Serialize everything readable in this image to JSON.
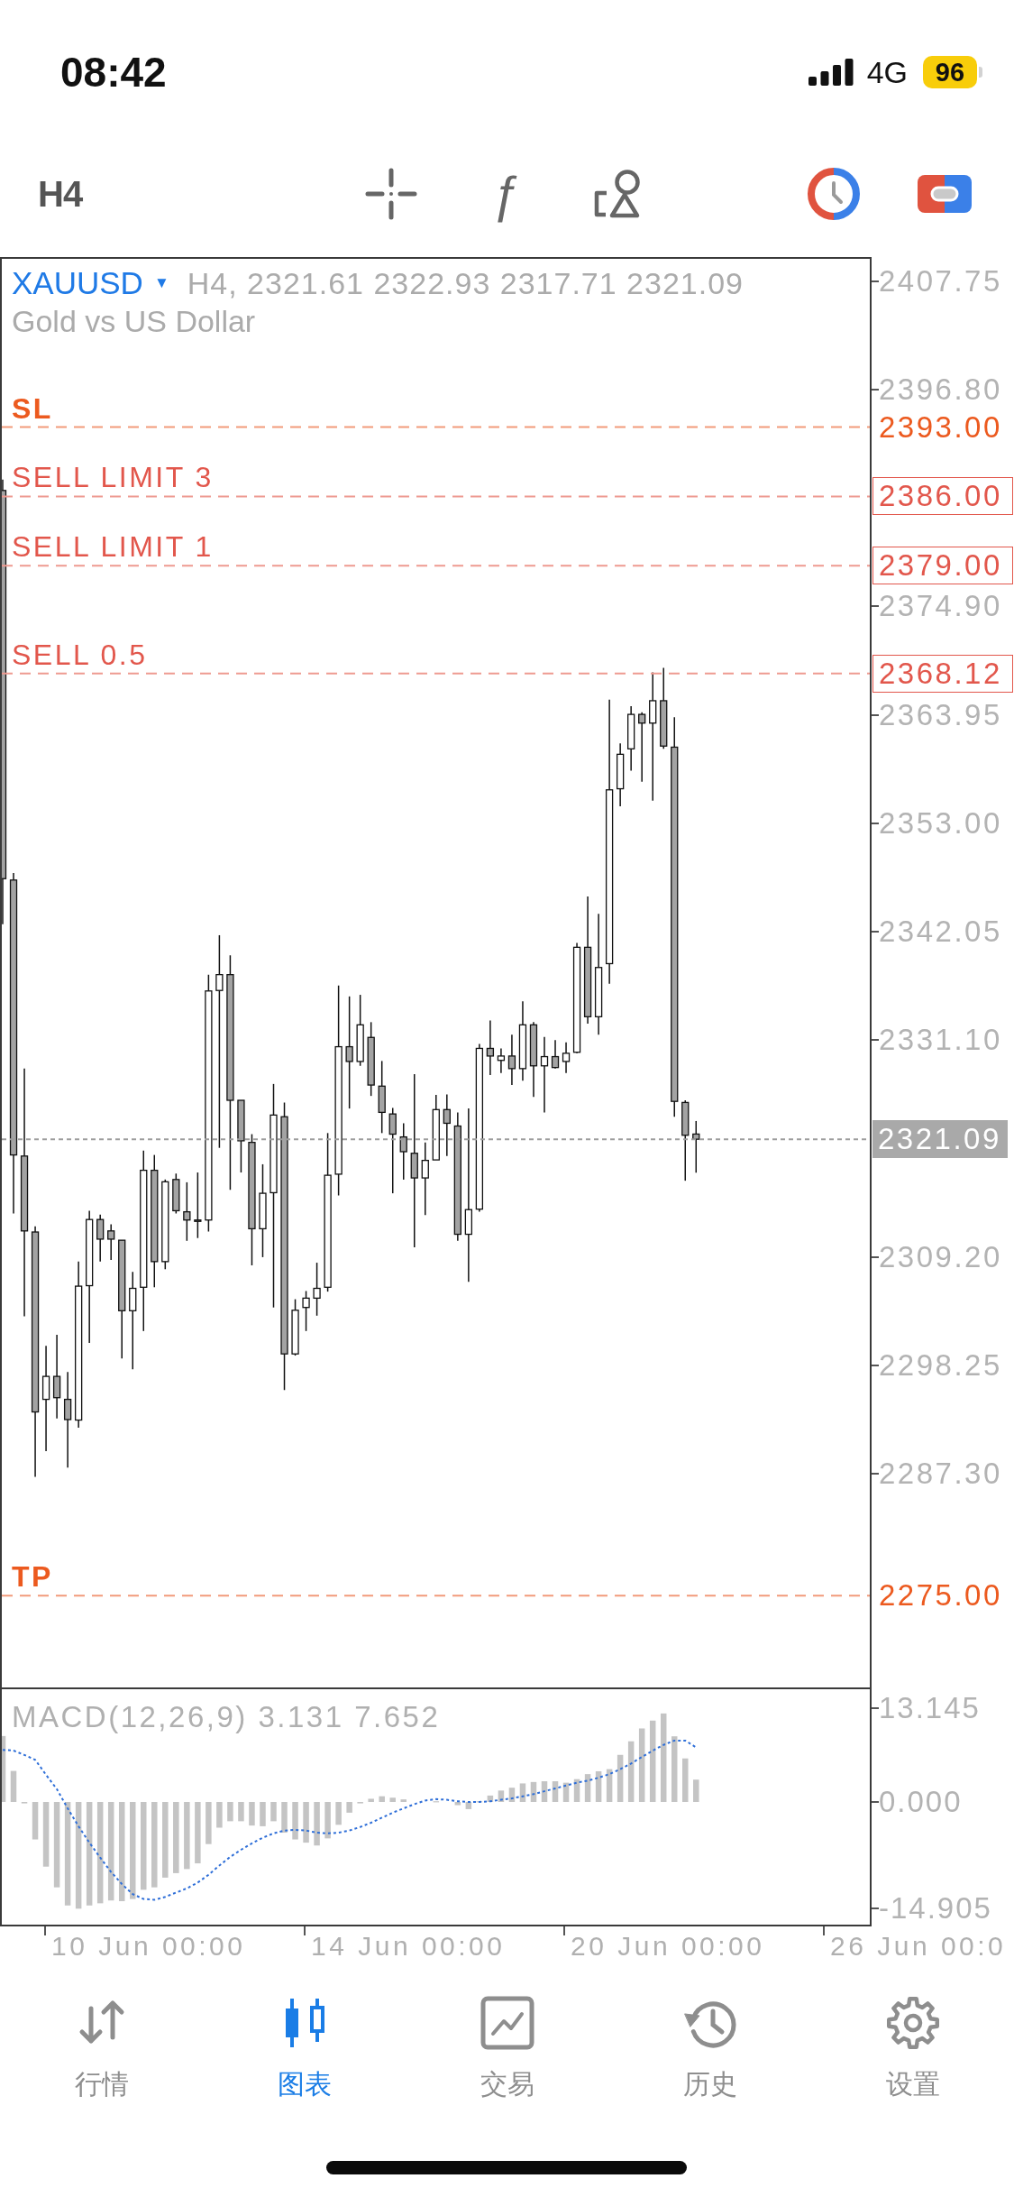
{
  "status_bar": {
    "time": "08:42",
    "network": "4G",
    "battery": "96"
  },
  "toolbar": {
    "timeframe": "H4",
    "indicator_symbol": "ƒ"
  },
  "chart": {
    "symbol": "XAUUSD",
    "symbol_caret": "▼",
    "quote": "H4, 2321.61 2322.93 2317.71 2321.09",
    "description": "Gold vs US Dollar",
    "price_axis": [
      "2407.75",
      "2396.80",
      "2374.90",
      "2363.95",
      "2353.00",
      "2342.05",
      "2331.10",
      "2309.20",
      "2298.25",
      "2287.30"
    ],
    "order_lines": [
      {
        "kind": "sl",
        "label": "SL",
        "price": "2393.00"
      },
      {
        "kind": "order",
        "label": "SELL LIMIT 3",
        "price": "2386.00"
      },
      {
        "kind": "order",
        "label": "SELL LIMIT 1",
        "price": "2379.00"
      },
      {
        "kind": "order",
        "label": "SELL 0.5",
        "price": "2368.12"
      },
      {
        "kind": "tp",
        "label": "TP",
        "price": "2275.00"
      }
    ],
    "current_price": "2321.09"
  },
  "indicator": {
    "name": "MACD(12,26,9)",
    "values": [
      "3.131",
      "7.652"
    ],
    "axis": [
      "13.145",
      "0.000",
      "-14.905"
    ]
  },
  "time_axis": [
    "10 Jun 00:00",
    "14 Jun 00:00",
    "20 Jun 00:00",
    "26 Jun 00:0"
  ],
  "tab_bar": [
    {
      "kind": "quotes",
      "label": "行情",
      "selected": false
    },
    {
      "kind": "chart",
      "label": "图表",
      "selected": true
    },
    {
      "kind": "trade",
      "label": "交易",
      "selected": false
    },
    {
      "kind": "history",
      "label": "历史",
      "selected": false
    },
    {
      "kind": "settings",
      "label": "设置",
      "selected": false
    }
  ]
}
